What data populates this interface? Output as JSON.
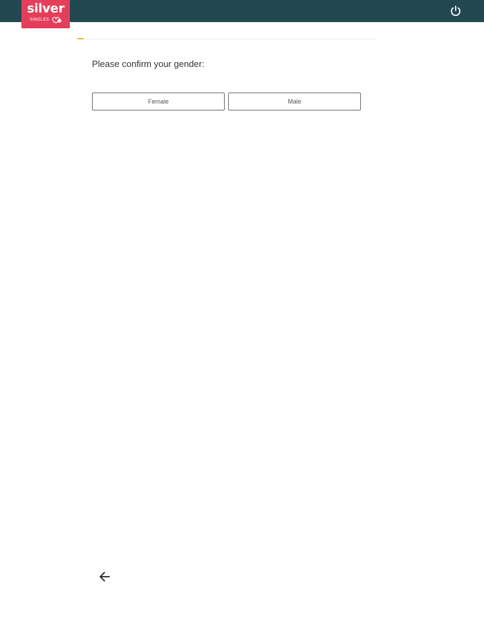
{
  "header": {
    "logo": {
      "main": "silver",
      "sub": "SINGLES"
    },
    "power_icon": "power-icon",
    "background_color": "#224850",
    "logo_color": "#e43f5a"
  },
  "progress": {
    "fraction": 0.02,
    "fill_color": "#f5b324"
  },
  "question": {
    "text": "Please confirm your gender:"
  },
  "options": [
    {
      "label": "Female"
    },
    {
      "label": "Male"
    }
  ],
  "footer": {
    "back_icon": "arrow-left-icon"
  }
}
